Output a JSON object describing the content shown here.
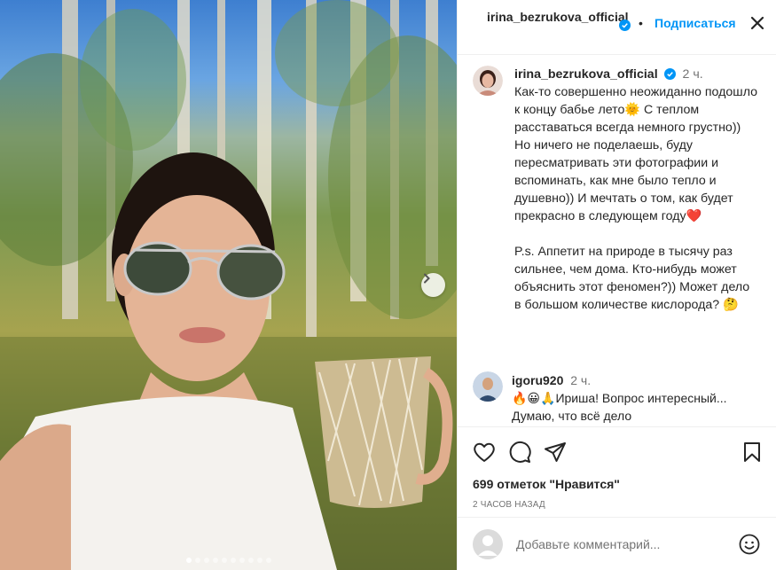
{
  "post": {
    "author": "irina_bezrukova_official",
    "follow_label": "Подписаться",
    "separator": "•",
    "caption": {
      "time": "2 ч.",
      "p1": "Как-то совершенно неожиданно подошло к концу бабье лето🌞 С теплом расставаться всегда немного грустно)) Но ничего не поделаешь, буду пересматривать эти фотографии и вспоминать, как мне было тепло и душевно)) И мечтать о том, как будет прекрасно в следующем году❤️",
      "p2": "P.s. Аппетит на природе в тысячу раз сильнее, чем дома. Кто-нибудь может объяснить этот феномен?)) Может дело в большом количестве кислорода? 🤔"
    },
    "comment": {
      "user": "igoru920",
      "time": "2 ч.",
      "text": "🔥😀🙏Ириша! Вопрос интересный... Думаю, что всё дело"
    },
    "likes": "699 отметок \"Нравится\"",
    "date": "2 ЧАСОВ НАЗАД",
    "add_comment_placeholder": "Добавьте комментарий...",
    "carousel": {
      "count": 10,
      "active": 0
    }
  },
  "icons": {
    "verified": "verified-badge-icon",
    "more": "more-options-icon",
    "like": "heart-icon",
    "comment": "comment-icon",
    "share": "share-icon",
    "save": "bookmark-icon",
    "next": "chevron-right-icon",
    "emoji": "emoji-icon"
  },
  "colors": {
    "link": "#0095f6",
    "text": "#262626",
    "muted": "#737373"
  }
}
